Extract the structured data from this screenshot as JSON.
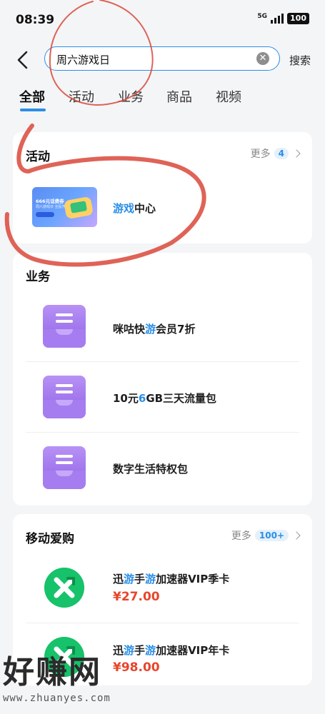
{
  "status_bar": {
    "time": "08:39",
    "network": "5G",
    "battery": "100"
  },
  "search": {
    "query": "周六游戏日",
    "button_label": "搜索"
  },
  "tabs": [
    {
      "label": "全部",
      "active": true
    },
    {
      "label": "活动"
    },
    {
      "label": "业务"
    },
    {
      "label": "商品"
    },
    {
      "label": "视频"
    }
  ],
  "activity": {
    "title": "活动",
    "more_label": "更多",
    "more_count": "4",
    "items": [
      {
        "thumb_headline": "666元话费券",
        "thumb_sub": "周六游戏日 全民开抢",
        "title_hl": "游戏",
        "title_rest": "中心"
      }
    ]
  },
  "business": {
    "title": "业务",
    "items": [
      {
        "t1": "咪咕快",
        "t2": "游",
        "t3": "会员7折"
      },
      {
        "t1": "10元",
        "t2": "6",
        "t3": "GB三天流量包"
      },
      {
        "t1": "数字生活特权包",
        "t2": "",
        "t3": ""
      }
    ]
  },
  "shopping": {
    "title": "移动爱购",
    "more_label": "更多",
    "more_count": "100+",
    "items": [
      {
        "p1": "迅",
        "h1": "游",
        "p2": "手",
        "h2": "游",
        "p3": "加速器VIP季卡",
        "price": "¥27.00"
      },
      {
        "p1": "迅",
        "h1": "游",
        "p2": "手",
        "h2": "游",
        "p3": "加速器VIP年卡",
        "price": "¥98.00"
      }
    ]
  },
  "watermark": {
    "text": "好赚网",
    "url": "www.zhuanyes.com"
  },
  "colors": {
    "accent": "#2a8ee6",
    "price": "#e8452b",
    "annotation": "#d9483a"
  }
}
